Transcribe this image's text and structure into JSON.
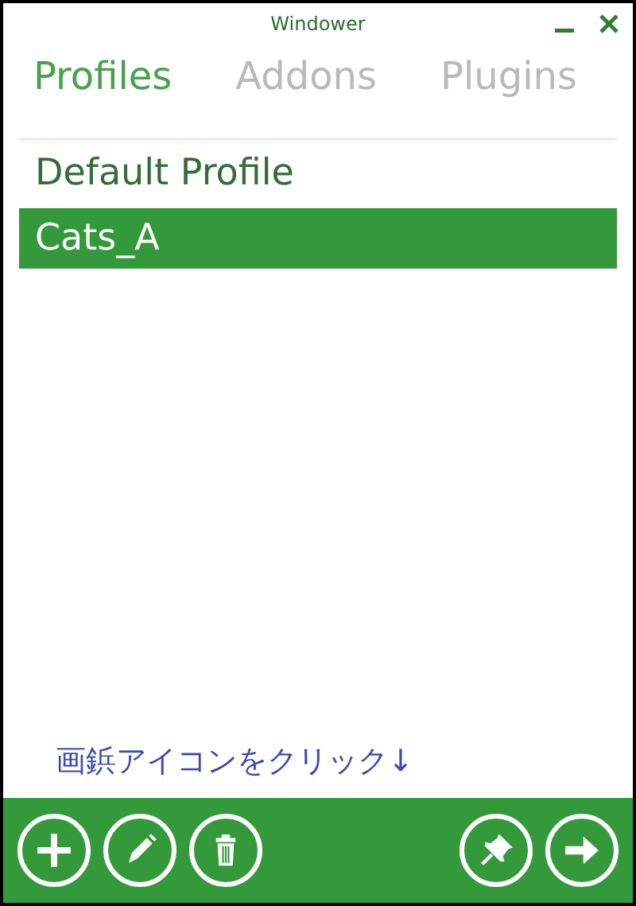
{
  "window": {
    "title": "Windower",
    "controls": [
      {
        "kind": "minimize"
      },
      {
        "kind": "close"
      }
    ]
  },
  "tabs": [
    {
      "label": "Profiles",
      "selected": true
    },
    {
      "label": "Addons",
      "selected": false
    },
    {
      "label": "Plugins",
      "selected": false
    }
  ],
  "profiles": [
    {
      "name": "Default Profile",
      "selected": false
    },
    {
      "name": "Cats_A",
      "selected": true
    }
  ],
  "note": "画鋲アイコンをクリック↓",
  "toolbar": {
    "left": [
      {
        "kind": "add"
      },
      {
        "kind": "edit"
      },
      {
        "kind": "delete"
      }
    ],
    "right": [
      {
        "kind": "pin"
      },
      {
        "kind": "next"
      }
    ]
  }
}
